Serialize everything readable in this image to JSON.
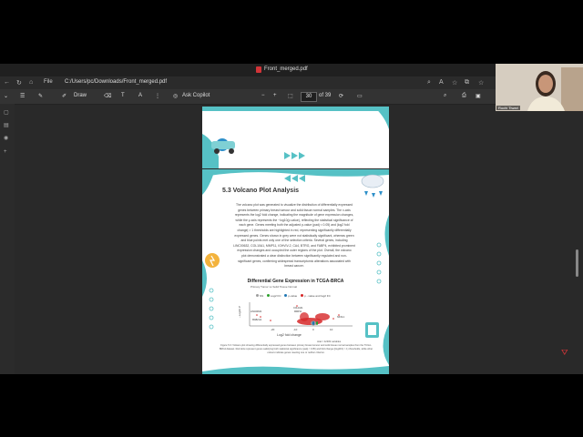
{
  "window": {
    "title": "Front_merged.pdf",
    "minimize": "—",
    "maximize": "▢",
    "close": "✕"
  },
  "address": {
    "file_label": "File",
    "url": "C:/Users/pc/Downloads/Front_merged.pdf"
  },
  "toolbar": {
    "draw_label": "Draw",
    "ask_copilot_label": "Ask Copilot",
    "zoom_out": "−",
    "zoom_in": "+",
    "page_current": "30",
    "page_total": "of 39"
  },
  "webcam": {
    "name": "Ruchi Tiwari"
  },
  "document": {
    "section_title": "5.3 Volcano Plot Analysis",
    "body_lines": [
      "The volcano plot was generated to visualize the distribution of differentially expressed",
      "genes between primary breast tumour and solid tissue normal samples. The x-axis",
      "represents the log2 fold change, indicating the magnitude of gene expression changes,",
      "while the y-axis represents the −log10(p-value), reflecting the statistical significance of",
      "each gene. Genes meeting both the adjusted p-value (padj < 0.05) and |log2 fold",
      "change| > 1 thresholds are highlighted in red, representing significantly differentially",
      "expressed genes. Genes shown in grey were not statistically significant, whereas green",
      "and blue points met only one of the selection criteria. Several genes, including",
      "LINC00632, COL10A1, MMP11, IGHVIV-2, CA4, BTRG, and FABP4, exhibited prominent",
      "expression changes and occupied the outer regions of the plot. Overall, the volcano",
      "plot demonstrated a clear distinction between significantly regulated and non-",
      "significant genes, confirming widespread transcriptomic alterations associated with",
      "breast cancer."
    ],
    "chart_title": "Differential Gene Expression in TCGA-BRCA",
    "chart_subtitle": "Primary Tumor vs Solid Tissue Normal",
    "legend": [
      "NS",
      "Log2 FC",
      "p-value",
      "p - value and log2 FC"
    ],
    "gene_labels": [
      "LINC00632",
      "COL10A1",
      "MMP11",
      "NKX2-1",
      "MAB21L1"
    ],
    "x_ticks": [
      "-20",
      "-10",
      "0",
      "10"
    ],
    "xlabel": "Log2 fold change",
    "ylabel": "−Log10 P",
    "total_label": "total = 42309 variables",
    "caption": "Figure 5.3: Volcano plot showing differentially expressed genes between primary breast tumour and solid tissue normal samples from the TCGA-BRCA dataset. Red dots represent genes satisfying both statistical significance (padj < 0.05) and fold change (|log2FC| > 1) thresholds, while other colours indicate genes meeting one or neither criterion."
  },
  "colors": {
    "teal": "#56c1c5",
    "red": "#d62728",
    "grey": "#9e9e9e",
    "green": "#2ca02c",
    "blue": "#1f77b4"
  }
}
